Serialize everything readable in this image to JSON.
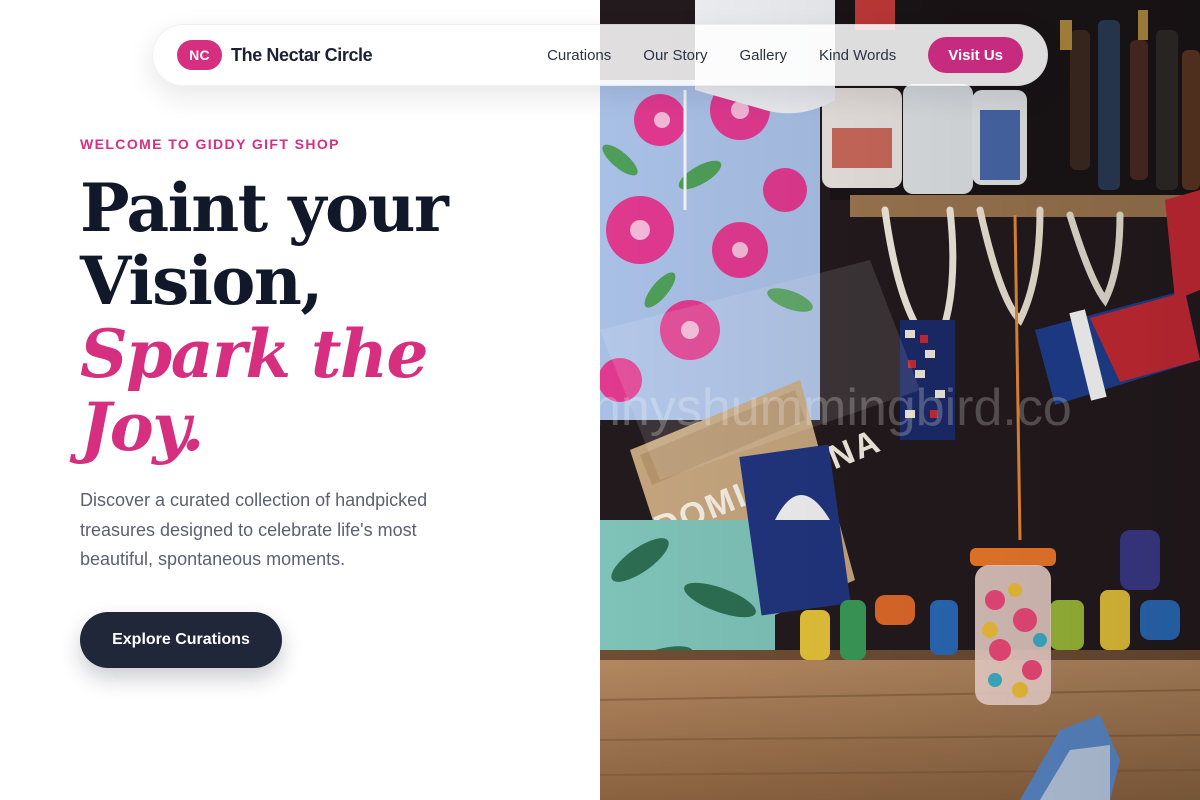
{
  "brand": {
    "badge": "NC",
    "name": "The Nectar Circle"
  },
  "nav": {
    "links": [
      "Curations",
      "Our Story",
      "Gallery",
      "Kind Words"
    ],
    "cta_label": "Visit Us"
  },
  "hero": {
    "eyebrow": "WELCOME TO GIDDY GIFT SHOP",
    "headline_line1": "Paint your",
    "headline_line2": "Vision,",
    "headline_accent1": "Spark the",
    "headline_accent2": "Joy.",
    "lead": "Discover a curated collection of handpicked treasures designed to celebrate life's most beautiful, spontaneous moments.",
    "cta_label": "Explore Curations"
  },
  "photo": {
    "bag_text": "DOMINICANA",
    "watermark": "nnyshummingbird.co"
  },
  "colors": {
    "accent": "#d62f80",
    "visit_button": "#c72b7f",
    "ink": "#101829",
    "cta_bg": "#1f2738"
  }
}
